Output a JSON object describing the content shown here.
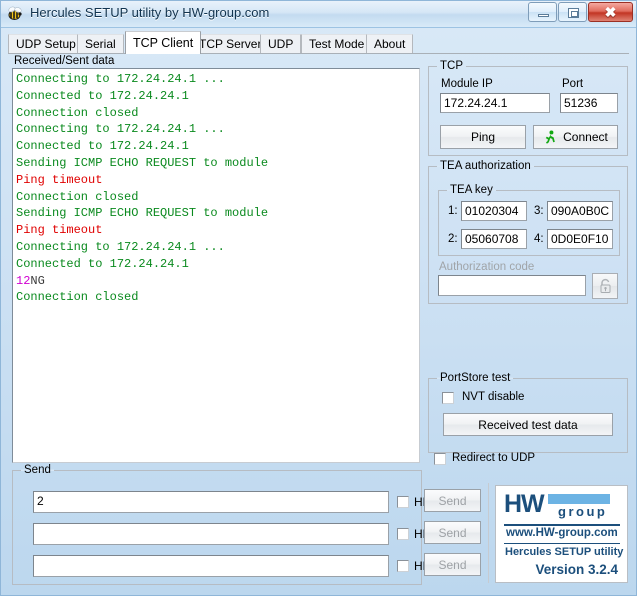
{
  "window": {
    "title": "Hercules SETUP utility by HW-group.com",
    "icon": "bee-icon",
    "minimize_label": "Minimize",
    "maximize_label": "Maximize",
    "close_label": "Close"
  },
  "tabs": [
    {
      "label": "UDP Setup",
      "active": false
    },
    {
      "label": "Serial",
      "active": false
    },
    {
      "label": "TCP Client",
      "active": true
    },
    {
      "label": "TCP Server",
      "active": false
    },
    {
      "label": "UDP",
      "active": false
    },
    {
      "label": "Test Mode",
      "active": false
    },
    {
      "label": "About",
      "active": false
    }
  ],
  "log": {
    "label": "Received/Sent data",
    "colors": {
      "green": "#0a8a1e",
      "red": "#e00000",
      "magenta": "#d000d0",
      "black": "#3a3a3a"
    },
    "lines": [
      {
        "text": "Connecting to 172.24.24.1 ...",
        "color": "green"
      },
      {
        "text": "Connected to 172.24.24.1",
        "color": "green"
      },
      {
        "text": "Connection closed",
        "color": "green"
      },
      {
        "text": "Connecting to 172.24.24.1 ...",
        "color": "green"
      },
      {
        "text": "Connected to 172.24.24.1",
        "color": "green"
      },
      {
        "text": "Sending ICMP ECHO REQUEST to module",
        "color": "green"
      },
      {
        "text": "Ping timeout",
        "color": "red"
      },
      {
        "text": "Connection closed",
        "color": "green"
      },
      {
        "text": "Sending ICMP ECHO REQUEST to module",
        "color": "green"
      },
      {
        "text": "Ping timeout",
        "color": "red"
      },
      {
        "text": "Connecting to 172.24.24.1 ...",
        "color": "green"
      },
      {
        "text": "Connected to 172.24.24.1",
        "color": "green"
      },
      {
        "segments": [
          {
            "text": "12",
            "color": "magenta"
          },
          {
            "text": "NG",
            "color": "black"
          }
        ]
      },
      {
        "text": "Connection closed",
        "color": "green"
      }
    ]
  },
  "tcp": {
    "group_label": "TCP",
    "module_ip_label": "Module IP",
    "module_ip_value": "172.24.24.1",
    "port_label": "Port",
    "port_value": "51236",
    "ping_label": "Ping",
    "connect_label": "Connect",
    "connect_icon": "runner-icon"
  },
  "tea": {
    "group_label": "TEA authorization",
    "key_group_label": "TEA key",
    "keys": [
      {
        "index": "1:",
        "value": "01020304"
      },
      {
        "index": "2:",
        "value": "05060708"
      },
      {
        "index": "3:",
        "value": "090A0B0C"
      },
      {
        "index": "4:",
        "value": "0D0E0F10"
      }
    ],
    "auth_code_label": "Authorization code",
    "auth_code_value": "",
    "lock_icon": "padlock-icon"
  },
  "portstore": {
    "group_label": "PortStore test",
    "nvt_disable_label": "NVT disable",
    "nvt_disable_checked": false,
    "received_test_data_label": "Received test data"
  },
  "redirect": {
    "label": "Redirect to UDP",
    "checked": false
  },
  "send": {
    "group_label": "Send",
    "rows": [
      {
        "value": "2",
        "hex_label": "HEX",
        "hex_checked": false,
        "button_label": "Send",
        "button_disabled": true
      },
      {
        "value": "",
        "hex_label": "HEX",
        "hex_checked": false,
        "button_label": "Send",
        "button_disabled": true
      },
      {
        "value": "",
        "hex_label": "HEX",
        "hex_checked": false,
        "button_label": "Send",
        "button_disabled": true
      }
    ]
  },
  "logo": {
    "hw": "HW",
    "group": "group",
    "url": "www.HW-group.com",
    "app": "Hercules SETUP utility",
    "version": "Version  3.2.4",
    "brand_color": "#1c4f7c",
    "accent_color": "#6cb3e4"
  }
}
